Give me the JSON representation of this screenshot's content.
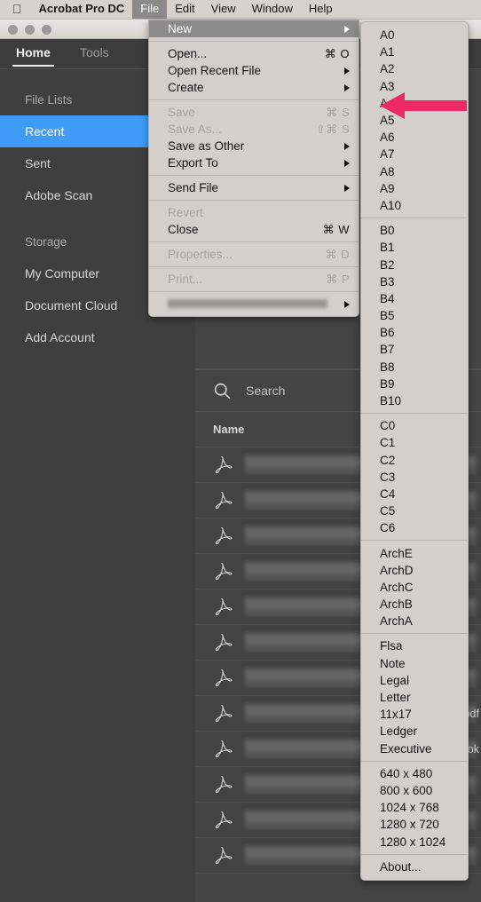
{
  "menubar": {
    "apple_icon": "apple-logo-icon",
    "app_name": "Acrobat Pro DC",
    "items": [
      {
        "label": "File",
        "active": true
      },
      {
        "label": "Edit",
        "active": false
      },
      {
        "label": "View",
        "active": false
      },
      {
        "label": "Window",
        "active": false
      },
      {
        "label": "Help",
        "active": false
      }
    ]
  },
  "window": {
    "tabs": [
      {
        "label": "Home",
        "selected": true
      },
      {
        "label": "Tools",
        "selected": false
      }
    ]
  },
  "sidebar": {
    "items": [
      {
        "label": "File Lists",
        "type": "header"
      },
      {
        "label": "Recent",
        "type": "item",
        "selected": true
      },
      {
        "label": "Sent",
        "type": "item"
      },
      {
        "label": "Adobe Scan",
        "type": "item"
      },
      {
        "label": "Storage",
        "type": "header"
      },
      {
        "label": "My Computer",
        "type": "item"
      },
      {
        "label": "Document Cloud",
        "type": "item"
      },
      {
        "label": "Add Account",
        "type": "item"
      }
    ]
  },
  "content": {
    "search": {
      "placeholder": "Search",
      "icon": "search-icon"
    },
    "column_header": "Name",
    "rows": [
      {
        "icon": "pdf-file-icon",
        "name_redacted": true,
        "fragment": ""
      },
      {
        "icon": "pdf-file-icon",
        "name_redacted": true,
        "fragment": ""
      },
      {
        "icon": "pdf-file-icon",
        "name_redacted": true,
        "fragment": ""
      },
      {
        "icon": "pdf-file-icon",
        "name_redacted": true,
        "fragment": ""
      },
      {
        "icon": "pdf-file-icon",
        "name_redacted": true,
        "fragment": ""
      },
      {
        "icon": "pdf-file-icon",
        "name_redacted": true,
        "fragment": ""
      },
      {
        "icon": "pdf-file-icon",
        "name_redacted": true,
        "fragment": ""
      },
      {
        "icon": "pdf-file-icon",
        "name_redacted": true,
        "fragment": "pdf"
      },
      {
        "icon": "pdf-file-icon",
        "name_redacted": true,
        "fragment": "_ok"
      },
      {
        "icon": "pdf-file-icon",
        "name_redacted": true,
        "fragment": ""
      },
      {
        "icon": "pdf-file-icon",
        "name_redacted": true,
        "fragment": ""
      },
      {
        "icon": "pdf-file-icon",
        "name_redacted": true,
        "fragment": ""
      }
    ]
  },
  "file_menu": {
    "groups": [
      [
        {
          "label": "New",
          "submenu": true,
          "highlighted": true,
          "enabled": true
        }
      ],
      [
        {
          "label": "Open...",
          "shortcut": "⌘ O",
          "enabled": true
        },
        {
          "label": "Open Recent File",
          "submenu": true,
          "enabled": true
        },
        {
          "label": "Create",
          "submenu": true,
          "enabled": true
        }
      ],
      [
        {
          "label": "Save",
          "shortcut": "⌘ S",
          "enabled": false
        },
        {
          "label": "Save As...",
          "shortcut": "⇧⌘ S",
          "enabled": false
        },
        {
          "label": "Save as Other",
          "submenu": true,
          "enabled": true
        },
        {
          "label": "Export To",
          "submenu": true,
          "enabled": true
        }
      ],
      [
        {
          "label": "Send File",
          "submenu": true,
          "enabled": true
        }
      ],
      [
        {
          "label": "Revert",
          "enabled": false
        },
        {
          "label": "Close",
          "shortcut": "⌘ W",
          "enabled": true
        }
      ],
      [
        {
          "label": "Properties...",
          "shortcut": "⌘ D",
          "enabled": false
        }
      ],
      [
        {
          "label": "Print...",
          "shortcut": "⌘ P",
          "enabled": false
        }
      ],
      [
        {
          "label": "",
          "redacted": true,
          "submenu": true,
          "enabled": true
        }
      ]
    ]
  },
  "new_submenu": {
    "groups": [
      [
        "A0",
        "A1",
        "A2",
        "A3",
        "A4",
        "A5",
        "A6",
        "A7",
        "A8",
        "A9",
        "A10"
      ],
      [
        "B0",
        "B1",
        "B2",
        "B3",
        "B4",
        "B5",
        "B6",
        "B7",
        "B8",
        "B9",
        "B10"
      ],
      [
        "C0",
        "C1",
        "C2",
        "C3",
        "C4",
        "C5",
        "C6"
      ],
      [
        "ArchE",
        "ArchD",
        "ArchC",
        "ArchB",
        "ArchA"
      ],
      [
        "Flsa",
        "Note",
        "Legal",
        "Letter",
        "11x17",
        "Ledger",
        "Executive"
      ],
      [
        "640 x 480",
        "800 x 600",
        "1024 x 768",
        "1280 x 720",
        "1280 x 1024"
      ],
      [
        "About..."
      ]
    ]
  },
  "annotation": {
    "arrow": {
      "name": "pointer-arrow",
      "color": "#ED2A63",
      "points_to": "A4",
      "direction": "left"
    }
  },
  "colors": {
    "accent_blue": "#3f9bf5",
    "menu_bg": "#d3d0cb",
    "menu_highlight": "#8b8b8b",
    "app_bg": "#3c3c3c",
    "annotation_pink": "#ED2A63"
  }
}
